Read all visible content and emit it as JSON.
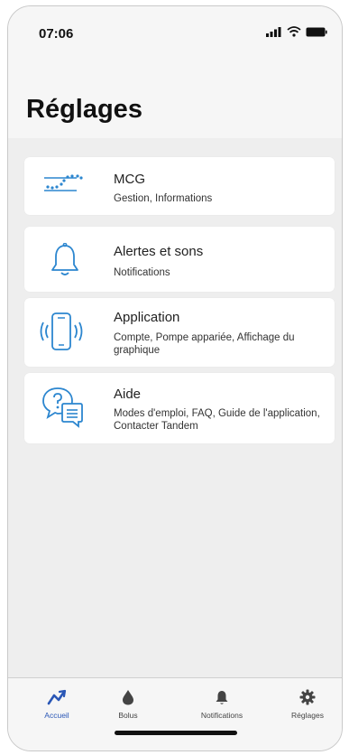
{
  "status_bar": {
    "time": "07:06"
  },
  "page": {
    "title": "Réglages"
  },
  "settings_items": [
    {
      "title": "MCG",
      "subtitle": "Gestion, Informations",
      "icon": "cgm-trend-icon"
    },
    {
      "title": "Alertes et sons",
      "subtitle": "Notifications",
      "icon": "bell-icon"
    },
    {
      "title": "Application",
      "subtitle": "Compte, Pompe appariée, Affichage du graphique",
      "icon": "phone-vibrate-icon"
    },
    {
      "title": "Aide",
      "subtitle": "Modes d'emploi, FAQ, Guide de l'application, Contacter Tandem",
      "icon": "help-chat-icon"
    }
  ],
  "tab_bar": {
    "tabs": [
      {
        "label": "Accueil",
        "icon": "trend-icon",
        "active": true
      },
      {
        "label": "Bolus",
        "icon": "drop-icon",
        "active": false
      },
      {
        "label": "Notifications",
        "icon": "bell-icon",
        "active": false
      },
      {
        "label": "Réglages",
        "icon": "gear-icon",
        "active": false
      }
    ]
  },
  "colors": {
    "accent": "#2a57b6",
    "icon_blue": "#2c86cf",
    "background": "#eeeeee"
  }
}
